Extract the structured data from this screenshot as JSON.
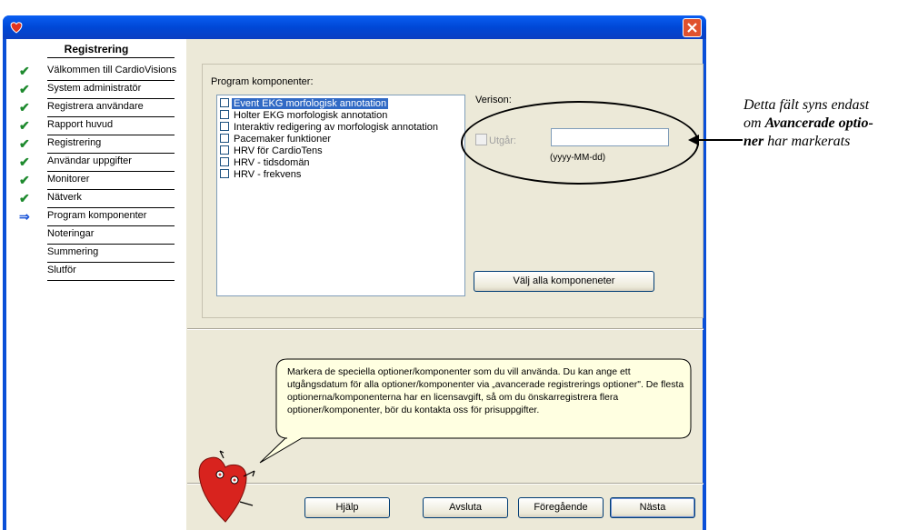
{
  "sidebar": {
    "title": "Registrering",
    "steps": [
      {
        "label": "Välkommen till CardioVisions",
        "status": "done"
      },
      {
        "label": "System administratör",
        "status": "done"
      },
      {
        "label": "Registrera användare",
        "status": "done"
      },
      {
        "label": "Rapport huvud",
        "status": "done"
      },
      {
        "label": "Registrering",
        "status": "done"
      },
      {
        "label": "Användar uppgifter",
        "status": "done"
      },
      {
        "label": "Monitorer",
        "status": "done"
      },
      {
        "label": "Nätverk",
        "status": "done"
      },
      {
        "label": "Program komponenter",
        "status": "current"
      },
      {
        "label": "Noteringar",
        "status": "pending"
      },
      {
        "label": "Summering",
        "status": "pending"
      },
      {
        "label": "Slutför",
        "status": "pending"
      }
    ]
  },
  "main": {
    "group_label": "Program komponenter:",
    "components": [
      {
        "label": "Event EKG morfologisk annotation",
        "selected": true,
        "checked": false
      },
      {
        "label": "Holter EKG morfologisk annotation",
        "selected": false,
        "checked": false
      },
      {
        "label": "Interaktiv redigering av morfologisk annotation",
        "selected": false,
        "checked": false
      },
      {
        "label": "Pacemaker funktioner",
        "selected": false,
        "checked": false
      },
      {
        "label": "HRV för CardioTens",
        "selected": false,
        "checked": false
      },
      {
        "label": "HRV - tidsdomän",
        "selected": false,
        "checked": false
      },
      {
        "label": "HRV - frekvens",
        "selected": false,
        "checked": false
      }
    ],
    "version_label": "Verison:",
    "expires_label": "Utgår:",
    "expires_value": "",
    "date_format_hint": "(yyyy-MM-dd)",
    "select_all_label": "Välj alla komponeneter"
  },
  "help_bubble": {
    "text": "Markera de speciella optioner/komponenter som du vill använda. Du kan ange ett utgångsdatum för alla optioner/komponenter via „avancerade registrerings optioner\". De flesta optionerna/komponenterna har en licensavgift, så om du önskarregistrera flera optioner/komponenter, bör du kontakta oss för prisuppgifter."
  },
  "buttons": {
    "help": "Hjälp",
    "cancel": "Avsluta",
    "back": "Föregående",
    "next": "Nästa"
  },
  "annotation": {
    "line1": "Detta fält syns endast",
    "line2_prefix": "om ",
    "line2_bold": "Avancerade optio-",
    "line3_bold": "ner",
    "line3_suffix": " har markerats"
  },
  "colors": {
    "titlebar": "#0a4fd8",
    "check": "#1e8a2e",
    "current_arrow": "#1d56d8",
    "selection": "#316ac5",
    "bubble": "#ffffe1",
    "mascot": "#d8231e"
  },
  "icons": {
    "app": "heart-logo-icon",
    "close": "close-icon",
    "done_step": "checkmark-icon",
    "current_step": "right-arrow-icon",
    "mascot": "heart-mascot"
  }
}
